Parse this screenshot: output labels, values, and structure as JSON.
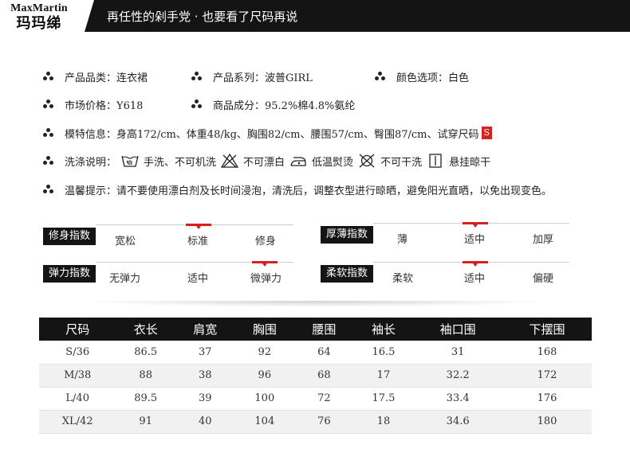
{
  "brand": {
    "en": "MaxMartin",
    "cn": "玛玛绨"
  },
  "header": {
    "title": "再任性的剁手党 · 也要看了尺码再说"
  },
  "info": {
    "category": "产品品类：连衣裙",
    "series": "产品系列：波普GIRL",
    "color": "颜色选项：白色",
    "price": "市场价格：Y618",
    "material": "商品成分：95.2%棉4.8%氨纶",
    "model": "模特信息：身高172/cm、体重48/kg、胸围82/cm、腰围57/cm、臀围87/cm、试穿尺码",
    "model_size": "S",
    "care_label": "洗涤说明：",
    "care": [
      "手洗、不可机洗",
      "不可漂白",
      "低温熨烫",
      "不可干洗",
      "悬挂晾干"
    ],
    "care_icons": [
      "hand-wash-icon",
      "no-bleach-icon",
      "low-iron-icon",
      "no-dry-clean-icon",
      "hang-dry-icon"
    ],
    "tips": "温馨提示：请不要使用漂白剂及长时间浸泡，清洗后，调整衣型进行晾晒，避免阳光直晒，以免出现变色。"
  },
  "indices": {
    "fit": {
      "label": "修身指数",
      "options": [
        "宽松",
        "标准",
        "修身"
      ],
      "selected": 1
    },
    "thickness": {
      "label": "厚薄指数",
      "options": [
        "薄",
        "适中",
        "加厚"
      ],
      "selected": 1
    },
    "elastic": {
      "label": "弹力指数",
      "options": [
        "无弹力",
        "适中",
        "微弹力"
      ],
      "selected": 2
    },
    "softness": {
      "label": "柔软指数",
      "options": [
        "柔软",
        "适中",
        "偏硬"
      ],
      "selected": 1
    }
  },
  "accent_color": "#d7211d",
  "size_table": {
    "headers": [
      "尺码",
      "衣长",
      "肩宽",
      "胸围",
      "腰围",
      "袖长",
      "袖口围",
      "下摆围"
    ],
    "rows": [
      [
        "S/36",
        "86.5",
        "37",
        "92",
        "64",
        "16.5",
        "31",
        "168"
      ],
      [
        "M/38",
        "88",
        "38",
        "96",
        "68",
        "17",
        "32.2",
        "172"
      ],
      [
        "L/40",
        "89.5",
        "39",
        "100",
        "72",
        "17.5",
        "33.4",
        "176"
      ],
      [
        "XL/42",
        "91",
        "40",
        "104",
        "76",
        "18",
        "34.6",
        "180"
      ]
    ]
  }
}
